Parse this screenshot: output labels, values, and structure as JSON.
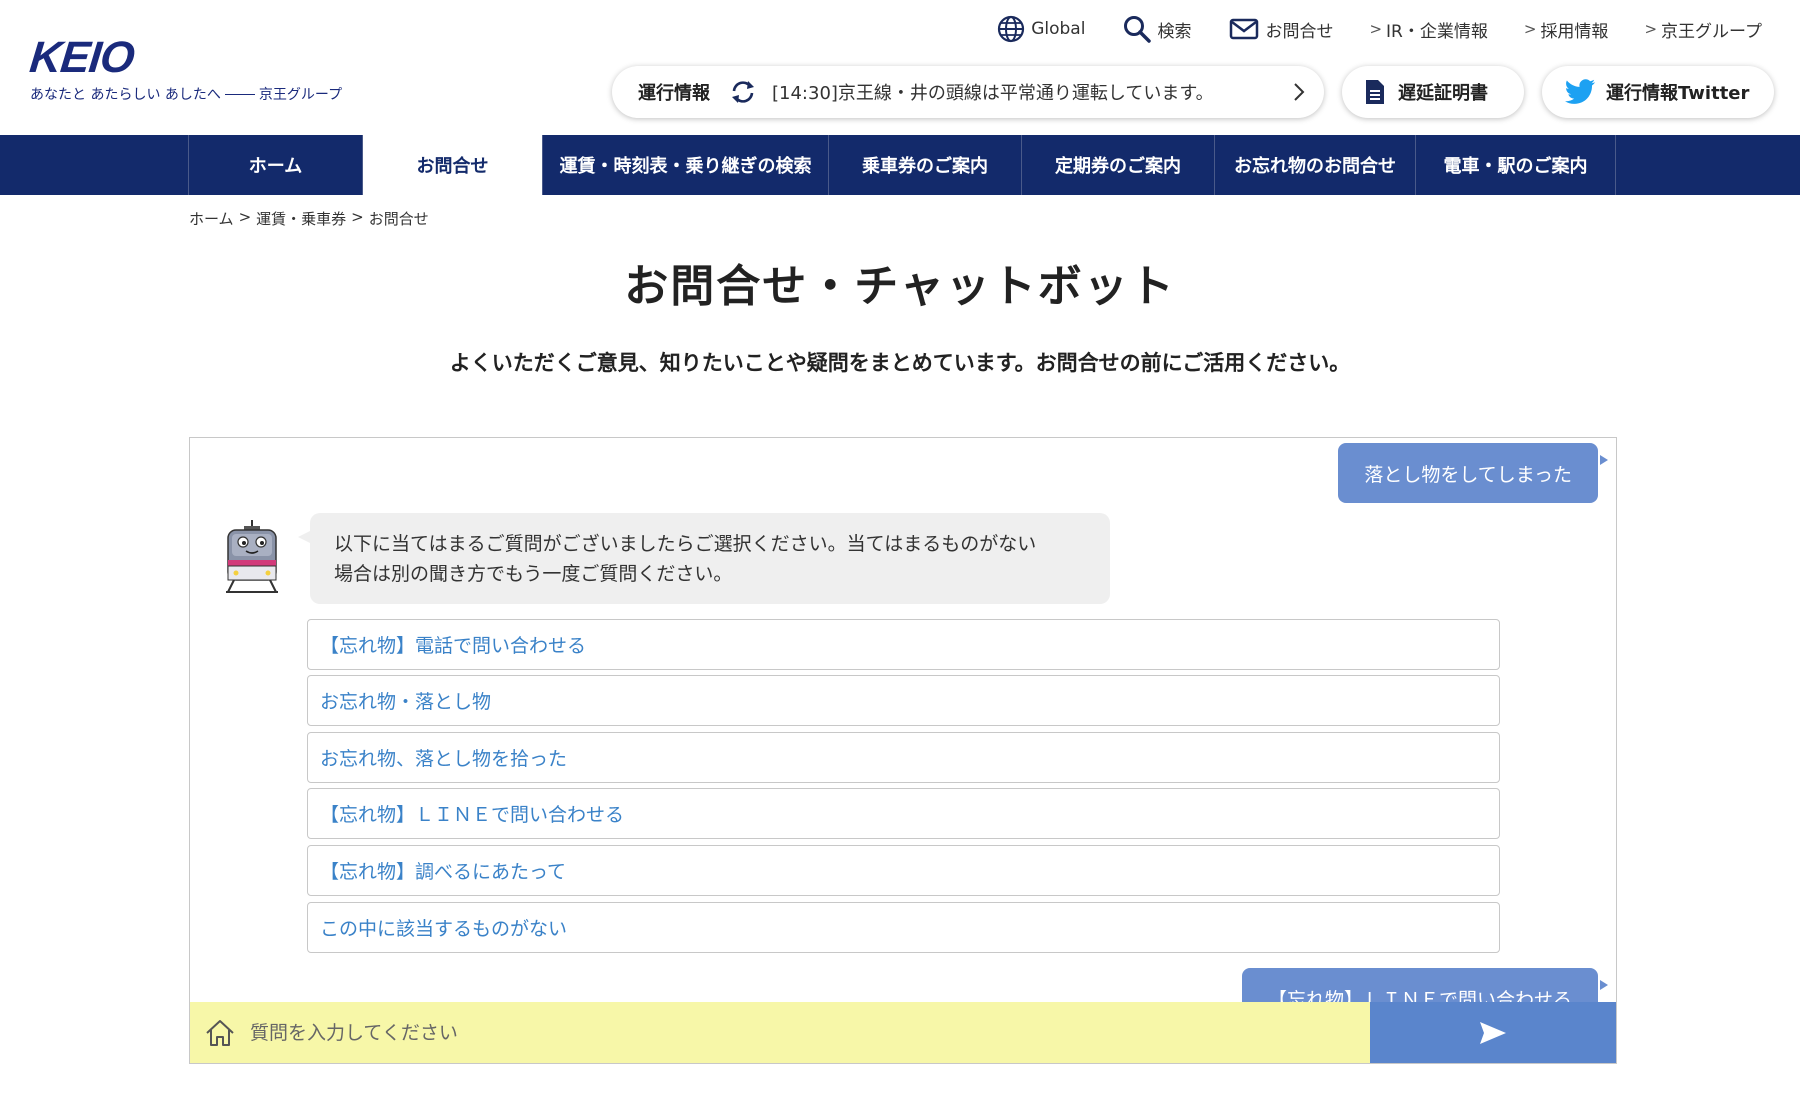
{
  "header": {
    "logo_text": "KEIO",
    "logo_tagline": "あなたと あたらしい あしたへ",
    "logo_group": "京王グループ",
    "top_links": [
      {
        "label": "Global",
        "icon": "globe-icon"
      },
      {
        "label": "検索",
        "icon": "search-icon"
      },
      {
        "label": "お問合せ",
        "icon": "mail-icon"
      },
      {
        "label": "IR・企業情報",
        "icon": "chevron-right-icon"
      },
      {
        "label": "採用情報",
        "icon": "chevron-right-icon"
      },
      {
        "label": "京王グループ",
        "icon": "chevron-right-icon"
      }
    ],
    "service_status": {
      "label": "運行情報",
      "message": "[14:30]京王線・井の頭線は平常通り運転しています。"
    },
    "delay_certificate": "遅延証明書",
    "twitter": "運行情報Twitter"
  },
  "nav": {
    "items": [
      {
        "label": "ホーム"
      },
      {
        "label": "お問合せ"
      },
      {
        "label": "運賃・時刻表・乗り継ぎの検索"
      },
      {
        "label": "乗車券のご案内"
      },
      {
        "label": "定期券のご案内"
      },
      {
        "label": "お忘れ物のお問合せ"
      },
      {
        "label": "電車・駅のご案内"
      }
    ],
    "active_index": 1
  },
  "breadcrumb": [
    "ホーム",
    "運賃・乗車券",
    "お問合せ"
  ],
  "breadcrumb_sep": ">",
  "page": {
    "title": "お問合せ・チャットボット",
    "subtitle": "よくいただくご意見、知りたいことや疑問をまとめています。お問合せの前にご活用ください。"
  },
  "chat": {
    "user_message_1": "落とし物をしてしまった",
    "bot_message_line1": "以下に当てはまるご質問がございましたらご選択ください。当てはまるものがない",
    "bot_message_line2": "場合は別の聞き方でもう一度ご質問ください。",
    "options": [
      "【忘れ物】電話で問い合わせる",
      "お忘れ物・落とし物",
      "お忘れ物、落とし物を拾った",
      "【忘れ物】ＬＩＮＥで問い合わせる",
      "【忘れ物】調べるにあたって",
      "この中に該当するものがない"
    ],
    "user_message_2": "【忘れ物】ＬＩＮＥで問い合わせる",
    "input_placeholder": "質問を入力してください"
  },
  "colors": {
    "brand_navy": "#132a6b",
    "user_bubble": "#6a8ed0",
    "send_button": "#5a85cc",
    "input_bg": "#f7f7a8",
    "option_text": "#3a82c8"
  }
}
